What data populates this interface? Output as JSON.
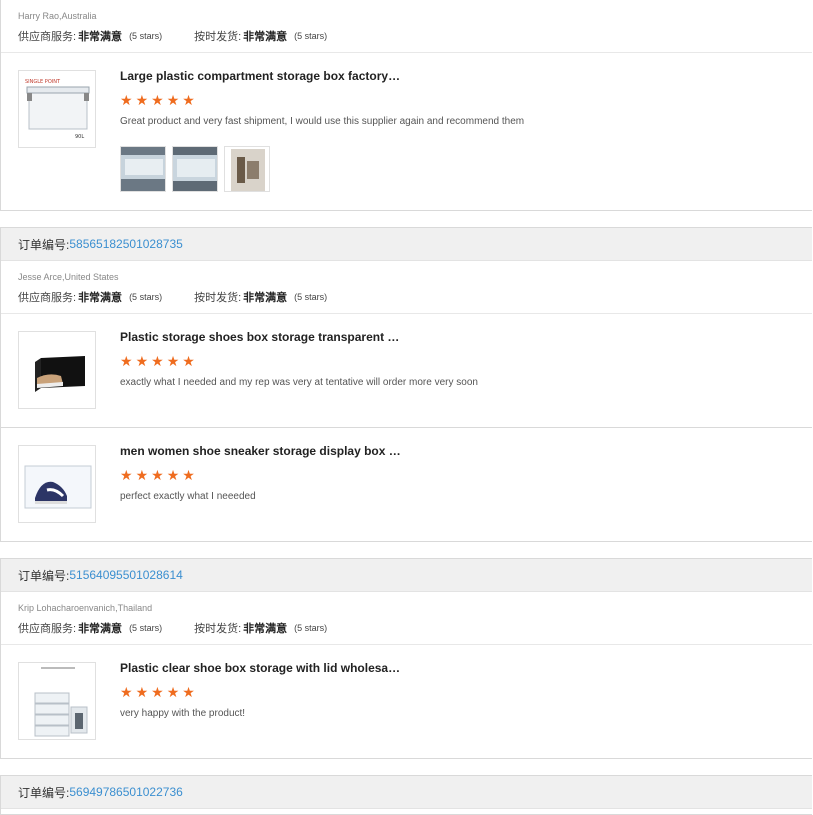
{
  "labels": {
    "order_no": "订单编号: ",
    "supplier_service": "供应商服务:",
    "ontime_delivery": "按时发货:"
  },
  "reviews": [
    {
      "buyer": "Harry Rao,Australia",
      "service_rating": "非常满意",
      "service_stars": "(5 stars)",
      "delivery_rating": "非常满意",
      "delivery_stars": "(5 stars)",
      "items": [
        {
          "title": "Large plastic compartment storage box factory…",
          "rating": 5,
          "comment": "Great product and very fast shipment, I would use this supplier again and recommend them",
          "thumb_icon": "clear-storage-box-image",
          "thumb_label": "SINGLE POINT",
          "thumb_size": "90L",
          "photos": [
            "box-photo-1",
            "box-photo-2",
            "box-photo-3"
          ]
        }
      ]
    },
    {
      "order_number": "58565182501028735",
      "buyer": "Jesse Arce,United States",
      "service_rating": "非常满意",
      "service_stars": "(5 stars)",
      "delivery_rating": "非常满意",
      "delivery_stars": "(5 stars)",
      "items": [
        {
          "title": "Plastic storage shoes box storage transparent …",
          "rating": 5,
          "comment": "exactly what I needed and my rep was very at tentative will order more very soon",
          "thumb_icon": "black-shoe-box-image"
        },
        {
          "title": "men women shoe sneaker storage display box …",
          "rating": 5,
          "comment": "perfect exactly what I neeeded",
          "thumb_icon": "clear-shoe-box-image"
        }
      ]
    },
    {
      "order_number": "51564095501028614",
      "buyer": "Krip Lohacharoenvanich,Thailand",
      "service_rating": "非常满意",
      "service_stars": "(5 stars)",
      "delivery_rating": "非常满意",
      "delivery_stars": "(5 stars)",
      "items": [
        {
          "title": "Plastic clear shoe box storage with lid wholesa…",
          "rating": 5,
          "comment": "very happy with the product!",
          "thumb_icon": "stacked-shoe-boxes-image"
        }
      ]
    },
    {
      "order_number": "56949786501022736"
    }
  ],
  "colors": {
    "star": "#ef6c1f",
    "order_number": "#3b8fd0"
  }
}
